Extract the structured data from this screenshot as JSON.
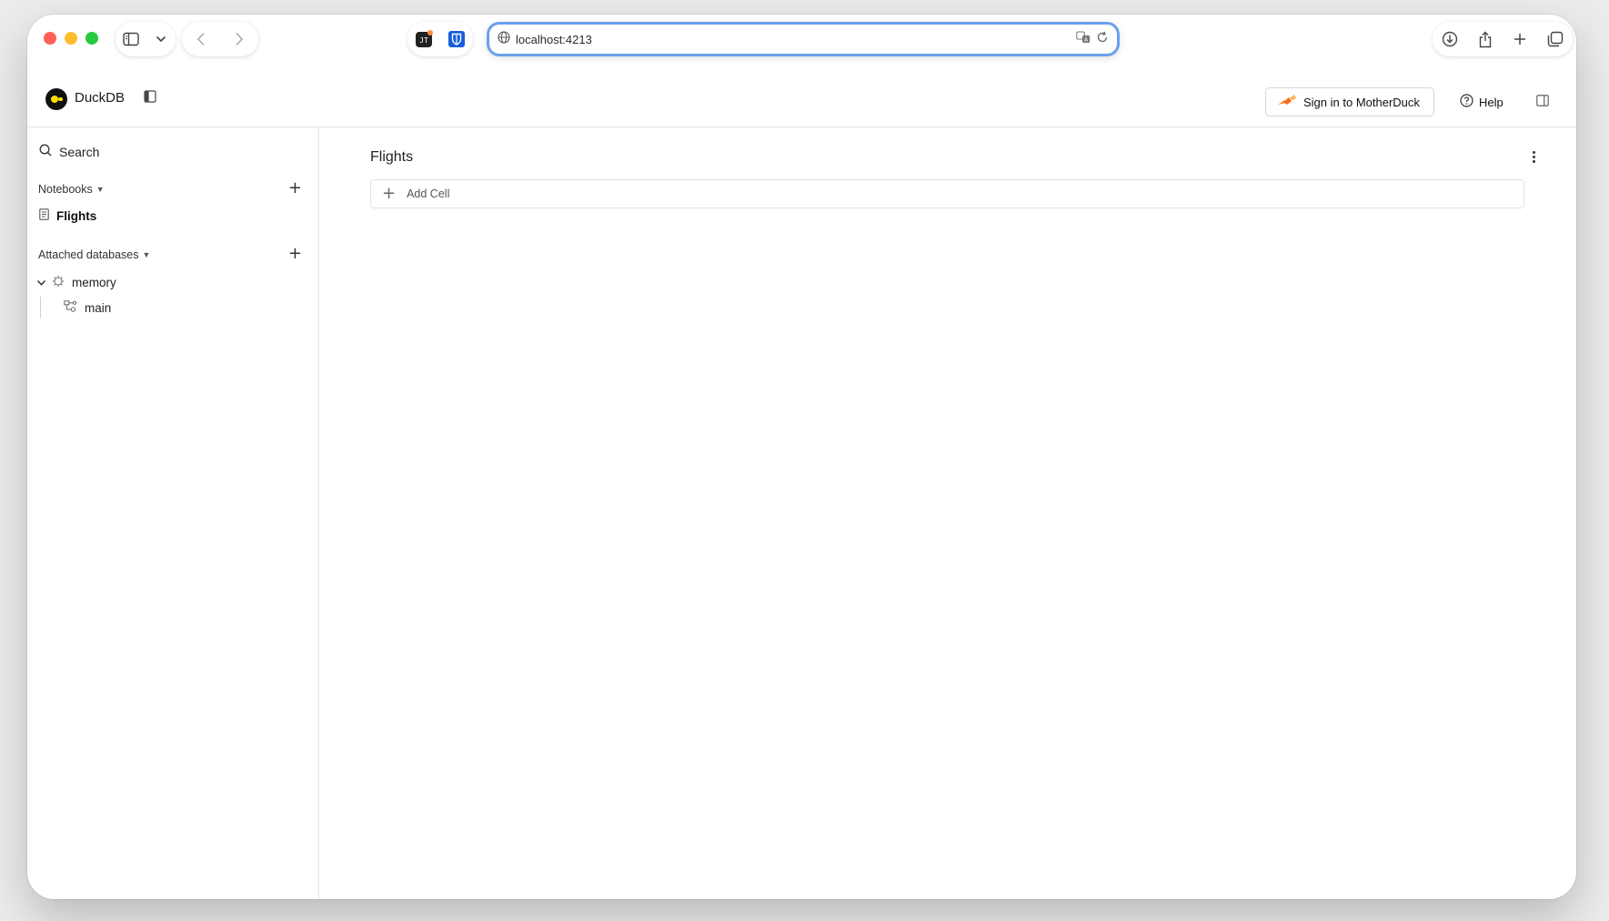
{
  "browser": {
    "url": "localhost:4213",
    "toolbar_icons": [
      "sidebar-icon",
      "chevron-down-icon",
      "back-icon",
      "forward-icon",
      "extension-icon",
      "bitwarden-icon",
      "globe-icon",
      "translate-icon",
      "reload-icon",
      "download-icon",
      "share-icon",
      "new-tab-icon",
      "tabs-overview-icon"
    ]
  },
  "header": {
    "app_name": "DuckDB",
    "motherduck_button": "Sign in to MotherDuck",
    "help_label": "Help"
  },
  "sidebar": {
    "search_label": "Search",
    "notebooks_heading": "Notebooks",
    "notebooks": [
      {
        "label": "Flights"
      }
    ],
    "databases_heading": "Attached databases",
    "databases": [
      {
        "label": "memory",
        "expanded": true,
        "schemas": [
          {
            "label": "main"
          }
        ]
      }
    ]
  },
  "main": {
    "notebook_title": "Flights",
    "add_cell_label": "Add Cell"
  },
  "colors": {
    "accent_focus": "#6aa0ec",
    "logo_yellow": "#ffe000",
    "motherduck_orange": "#ff8a3d"
  }
}
